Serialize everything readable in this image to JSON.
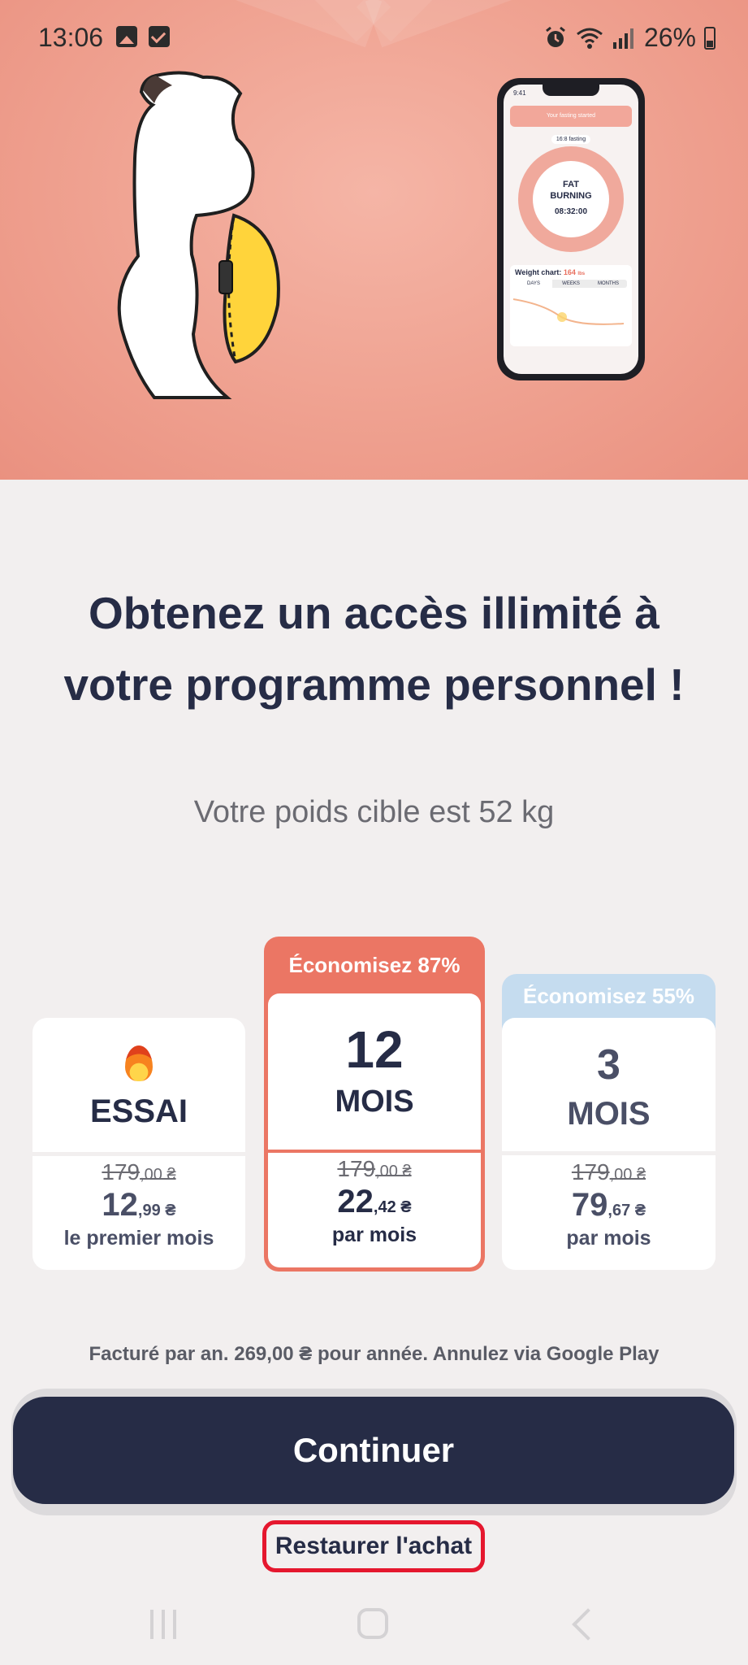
{
  "status_bar": {
    "time": "13:06",
    "battery": "26%",
    "icons": [
      "image-icon",
      "check-icon",
      "alarm-icon",
      "wifi-icon",
      "signal-icon",
      "battery-icon"
    ]
  },
  "hero": {
    "phone": {
      "time": "9:41",
      "banner": "Your fasting started",
      "chip": "16:8 fasting",
      "status_line1": "FAT",
      "status_line2": "BURNING",
      "timer": "08:32:00",
      "weight_label": "Weight chart:",
      "weight_value": "164",
      "weight_unit": "lbs",
      "tabs": [
        "DAYS",
        "WEEKS",
        "MONTHS"
      ]
    }
  },
  "headline": {
    "line1": "Obtenez un accès illimité à",
    "line2": "votre programme personnel !"
  },
  "subtitle": "Votre poids cible est 52 kg",
  "plans": {
    "essai": {
      "label": "ESSAI",
      "old_price_int": "179",
      "old_price_dec": ",00 ₴",
      "price_int": "12",
      "price_dec": ",99 ₴",
      "period": "le premier mois"
    },
    "twelve": {
      "banner": "Économisez 87%",
      "number": "12",
      "label": "MOIS",
      "old_price_int": "179",
      "old_price_dec": ",00 ₴",
      "price_int": "22",
      "price_dec": ",42 ₴",
      "period": "par mois"
    },
    "three": {
      "banner": "Économisez 55%",
      "number": "3",
      "label": "MOIS",
      "old_price_int": "179",
      "old_price_dec": ",00 ₴",
      "price_int": "79",
      "price_dec": ",67 ₴",
      "period": "par mois"
    }
  },
  "billing_note": "Facturé par an. 269,00 ₴ pour année. Annulez via Google Play",
  "continue_label": "Continuer",
  "restore_label": "Restaurer l'achat",
  "colors": {
    "hero_bg": "#efa190",
    "primary": "#262c46",
    "accent": "#eb7664",
    "badge_blue": "#c5dcef",
    "highlight_box": "#e5172e"
  }
}
